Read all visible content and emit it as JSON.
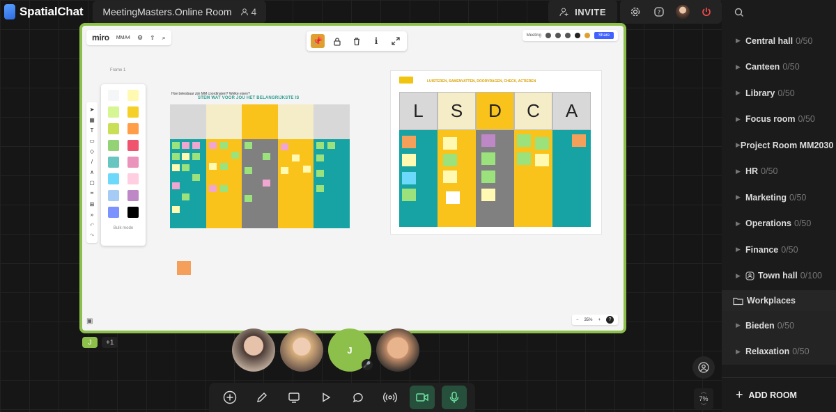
{
  "app": {
    "name": "SpatialChat",
    "room_title": "MeetingMasters.Online Room",
    "participant_count": "4"
  },
  "top": {
    "invite_label": "INVITE"
  },
  "sidebar": {
    "rooms": [
      {
        "name": "Central hall",
        "cap": "0/50"
      },
      {
        "name": "Canteen",
        "cap": "0/50"
      },
      {
        "name": "Library",
        "cap": "0/50"
      },
      {
        "name": "Focus room",
        "cap": "0/50"
      },
      {
        "name": "Project Room MM2030",
        "cap": ""
      },
      {
        "name": "HR",
        "cap": "0/50"
      },
      {
        "name": "Marketing",
        "cap": "0/50"
      },
      {
        "name": "Operations",
        "cap": "0/50"
      },
      {
        "name": "Finance",
        "cap": "0/50"
      },
      {
        "name": "Town hall",
        "cap": "0/100"
      }
    ],
    "folder": "Workplaces",
    "sub_rooms": [
      {
        "name": "Bieden",
        "cap": "0/50"
      },
      {
        "name": "Relaxation",
        "cap": "0/50"
      }
    ],
    "add_room": "ADD ROOM"
  },
  "miro": {
    "logo": "miro",
    "board": "MMA4",
    "frame_label": "Frame 1",
    "f1_title": "Hoe belesbaar zijn MM coordinaten? Welke eisen?",
    "f1_subtitle": "STEM WAT VOOR JOU HET BELANGRIJKSTE IS",
    "f2_title": "LUISTEREN, SAMENVATTEN, DOORVRAGEN, CHECK, ACTIEREN",
    "lsdca": [
      "L",
      "S",
      "D",
      "C",
      "A"
    ],
    "zoom": "35%",
    "bulk_mode": "Bulk mode",
    "meeting": "Meeting",
    "share": "Share"
  },
  "badges": {
    "j": "J",
    "plus": "+1"
  },
  "participants": {
    "initial": "J"
  },
  "zoom_level": "7%",
  "colors": {
    "accent": "#8dc04b",
    "brand": "#2c6be0",
    "mic_active": "#6ee3a0",
    "end_call": "#ff4d4d"
  }
}
